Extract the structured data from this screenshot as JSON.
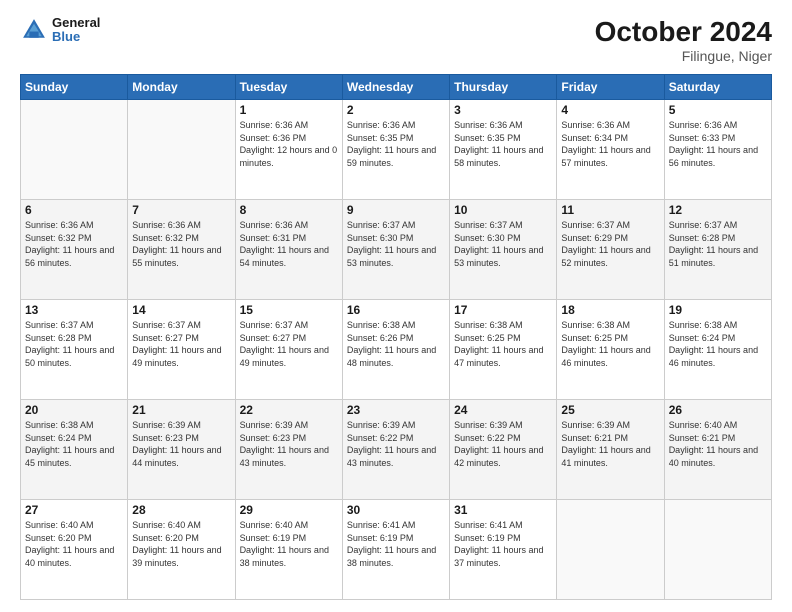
{
  "header": {
    "logo": {
      "line1": "General",
      "line2": "Blue"
    },
    "title": "October 2024",
    "location": "Filingue, Niger"
  },
  "days_of_week": [
    "Sunday",
    "Monday",
    "Tuesday",
    "Wednesday",
    "Thursday",
    "Friday",
    "Saturday"
  ],
  "weeks": [
    [
      {
        "day": "",
        "info": ""
      },
      {
        "day": "",
        "info": ""
      },
      {
        "day": "1",
        "sunrise": "Sunrise: 6:36 AM",
        "sunset": "Sunset: 6:36 PM",
        "daylight": "Daylight: 12 hours and 0 minutes."
      },
      {
        "day": "2",
        "sunrise": "Sunrise: 6:36 AM",
        "sunset": "Sunset: 6:35 PM",
        "daylight": "Daylight: 11 hours and 59 minutes."
      },
      {
        "day": "3",
        "sunrise": "Sunrise: 6:36 AM",
        "sunset": "Sunset: 6:35 PM",
        "daylight": "Daylight: 11 hours and 58 minutes."
      },
      {
        "day": "4",
        "sunrise": "Sunrise: 6:36 AM",
        "sunset": "Sunset: 6:34 PM",
        "daylight": "Daylight: 11 hours and 57 minutes."
      },
      {
        "day": "5",
        "sunrise": "Sunrise: 6:36 AM",
        "sunset": "Sunset: 6:33 PM",
        "daylight": "Daylight: 11 hours and 56 minutes."
      }
    ],
    [
      {
        "day": "6",
        "sunrise": "Sunrise: 6:36 AM",
        "sunset": "Sunset: 6:32 PM",
        "daylight": "Daylight: 11 hours and 56 minutes."
      },
      {
        "day": "7",
        "sunrise": "Sunrise: 6:36 AM",
        "sunset": "Sunset: 6:32 PM",
        "daylight": "Daylight: 11 hours and 55 minutes."
      },
      {
        "day": "8",
        "sunrise": "Sunrise: 6:36 AM",
        "sunset": "Sunset: 6:31 PM",
        "daylight": "Daylight: 11 hours and 54 minutes."
      },
      {
        "day": "9",
        "sunrise": "Sunrise: 6:37 AM",
        "sunset": "Sunset: 6:30 PM",
        "daylight": "Daylight: 11 hours and 53 minutes."
      },
      {
        "day": "10",
        "sunrise": "Sunrise: 6:37 AM",
        "sunset": "Sunset: 6:30 PM",
        "daylight": "Daylight: 11 hours and 53 minutes."
      },
      {
        "day": "11",
        "sunrise": "Sunrise: 6:37 AM",
        "sunset": "Sunset: 6:29 PM",
        "daylight": "Daylight: 11 hours and 52 minutes."
      },
      {
        "day": "12",
        "sunrise": "Sunrise: 6:37 AM",
        "sunset": "Sunset: 6:28 PM",
        "daylight": "Daylight: 11 hours and 51 minutes."
      }
    ],
    [
      {
        "day": "13",
        "sunrise": "Sunrise: 6:37 AM",
        "sunset": "Sunset: 6:28 PM",
        "daylight": "Daylight: 11 hours and 50 minutes."
      },
      {
        "day": "14",
        "sunrise": "Sunrise: 6:37 AM",
        "sunset": "Sunset: 6:27 PM",
        "daylight": "Daylight: 11 hours and 49 minutes."
      },
      {
        "day": "15",
        "sunrise": "Sunrise: 6:37 AM",
        "sunset": "Sunset: 6:27 PM",
        "daylight": "Daylight: 11 hours and 49 minutes."
      },
      {
        "day": "16",
        "sunrise": "Sunrise: 6:38 AM",
        "sunset": "Sunset: 6:26 PM",
        "daylight": "Daylight: 11 hours and 48 minutes."
      },
      {
        "day": "17",
        "sunrise": "Sunrise: 6:38 AM",
        "sunset": "Sunset: 6:25 PM",
        "daylight": "Daylight: 11 hours and 47 minutes."
      },
      {
        "day": "18",
        "sunrise": "Sunrise: 6:38 AM",
        "sunset": "Sunset: 6:25 PM",
        "daylight": "Daylight: 11 hours and 46 minutes."
      },
      {
        "day": "19",
        "sunrise": "Sunrise: 6:38 AM",
        "sunset": "Sunset: 6:24 PM",
        "daylight": "Daylight: 11 hours and 46 minutes."
      }
    ],
    [
      {
        "day": "20",
        "sunrise": "Sunrise: 6:38 AM",
        "sunset": "Sunset: 6:24 PM",
        "daylight": "Daylight: 11 hours and 45 minutes."
      },
      {
        "day": "21",
        "sunrise": "Sunrise: 6:39 AM",
        "sunset": "Sunset: 6:23 PM",
        "daylight": "Daylight: 11 hours and 44 minutes."
      },
      {
        "day": "22",
        "sunrise": "Sunrise: 6:39 AM",
        "sunset": "Sunset: 6:23 PM",
        "daylight": "Daylight: 11 hours and 43 minutes."
      },
      {
        "day": "23",
        "sunrise": "Sunrise: 6:39 AM",
        "sunset": "Sunset: 6:22 PM",
        "daylight": "Daylight: 11 hours and 43 minutes."
      },
      {
        "day": "24",
        "sunrise": "Sunrise: 6:39 AM",
        "sunset": "Sunset: 6:22 PM",
        "daylight": "Daylight: 11 hours and 42 minutes."
      },
      {
        "day": "25",
        "sunrise": "Sunrise: 6:39 AM",
        "sunset": "Sunset: 6:21 PM",
        "daylight": "Daylight: 11 hours and 41 minutes."
      },
      {
        "day": "26",
        "sunrise": "Sunrise: 6:40 AM",
        "sunset": "Sunset: 6:21 PM",
        "daylight": "Daylight: 11 hours and 40 minutes."
      }
    ],
    [
      {
        "day": "27",
        "sunrise": "Sunrise: 6:40 AM",
        "sunset": "Sunset: 6:20 PM",
        "daylight": "Daylight: 11 hours and 40 minutes."
      },
      {
        "day": "28",
        "sunrise": "Sunrise: 6:40 AM",
        "sunset": "Sunset: 6:20 PM",
        "daylight": "Daylight: 11 hours and 39 minutes."
      },
      {
        "day": "29",
        "sunrise": "Sunrise: 6:40 AM",
        "sunset": "Sunset: 6:19 PM",
        "daylight": "Daylight: 11 hours and 38 minutes."
      },
      {
        "day": "30",
        "sunrise": "Sunrise: 6:41 AM",
        "sunset": "Sunset: 6:19 PM",
        "daylight": "Daylight: 11 hours and 38 minutes."
      },
      {
        "day": "31",
        "sunrise": "Sunrise: 6:41 AM",
        "sunset": "Sunset: 6:19 PM",
        "daylight": "Daylight: 11 hours and 37 minutes."
      },
      {
        "day": "",
        "info": ""
      },
      {
        "day": "",
        "info": ""
      }
    ]
  ]
}
